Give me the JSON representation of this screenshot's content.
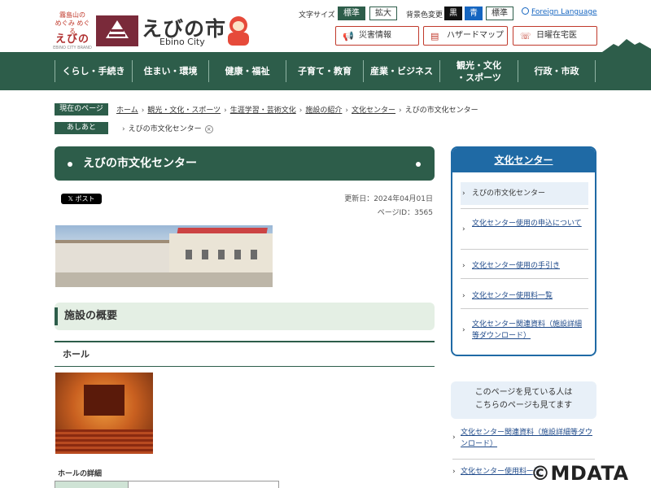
{
  "header": {
    "logo_small": {
      "line1": "霧島山の",
      "line2": "めぐみ めぐる",
      "line3": "えびの",
      "line4": "EBINO CITY BRAND"
    },
    "city_name": "えびの市",
    "city_name_en": "Ebino City",
    "font_size_label": "文字サイズ",
    "font_size_standard": "標準",
    "font_size_large": "拡大",
    "bg_color_label": "背景色変更",
    "bg_black": "黒",
    "bg_blue": "青",
    "bg_standard": "標準",
    "language_link": "Foreign Language",
    "buttons": [
      {
        "label": "災害情報",
        "icon": "megaphone-icon"
      },
      {
        "label": "ハザードマップ",
        "icon": "map-icon"
      },
      {
        "label": "日曜在宅医",
        "icon": "phone-icon"
      }
    ]
  },
  "nav": {
    "items": [
      {
        "line1": "くらし・手続き",
        "line2": ""
      },
      {
        "line1": "住まい・環境",
        "line2": ""
      },
      {
        "line1": "健康・福祉",
        "line2": ""
      },
      {
        "line1": "子育て・教育",
        "line2": ""
      },
      {
        "line1": "産業・ビジネス",
        "line2": ""
      },
      {
        "line1": "観光・文化",
        "line2": "・スポーツ"
      },
      {
        "line1": "行政・市政",
        "line2": ""
      }
    ]
  },
  "breadcrumb": {
    "current_label": "現在のページ",
    "items": [
      "ホーム",
      "観光・文化・スポーツ",
      "生涯学習・芸術文化",
      "施設の紹介",
      "文化センター"
    ],
    "current": "えびの市文化センター",
    "history_label": "あしあと",
    "history_items": [
      "えびの市文化センター"
    ]
  },
  "main": {
    "title": "えびの市文化センター",
    "x_post": "𝕏 ポスト",
    "updated": "更新日：2024年04月01日",
    "page_id": "ページID：3565",
    "section_title": "施設の概要",
    "sub_title": "ホール",
    "detail_label": "ホールの詳細"
  },
  "sidebar": {
    "heading": "文化センター",
    "items": [
      {
        "label": "えびの市文化センター",
        "current": true
      },
      {
        "label": "文化センター使用の申込について",
        "current": false
      },
      {
        "label": "文化センター使用の手引き",
        "current": false
      },
      {
        "label": "文化センター使用料一覧",
        "current": false
      },
      {
        "label": "文化センター関連資料（施設詳細等ダウンロード）",
        "current": false
      }
    ],
    "see_also_line1": "このページを見ている人は",
    "see_also_line2": "こちらのページも見てます",
    "see_also_links": [
      "文化センター関連資料（施設詳細等ダウンロード）",
      "文化センター使用料一覧"
    ]
  },
  "watermark": "©MDATA",
  "colors": {
    "primary": "#2d5d4a",
    "accent_blue": "#1f6aa5",
    "alert_red": "#c0392b"
  }
}
